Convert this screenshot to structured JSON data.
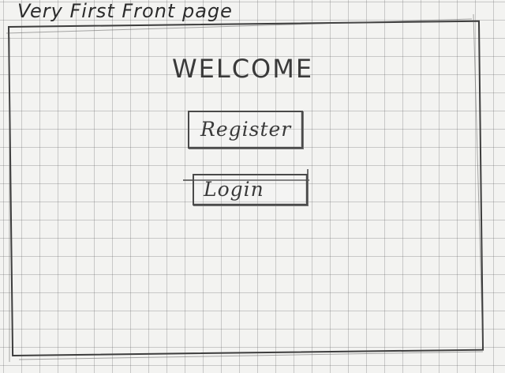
{
  "page": {
    "title": "Very First Front page"
  },
  "main": {
    "heading": "WELCOME",
    "register_label": "Register",
    "login_label": "Login"
  }
}
